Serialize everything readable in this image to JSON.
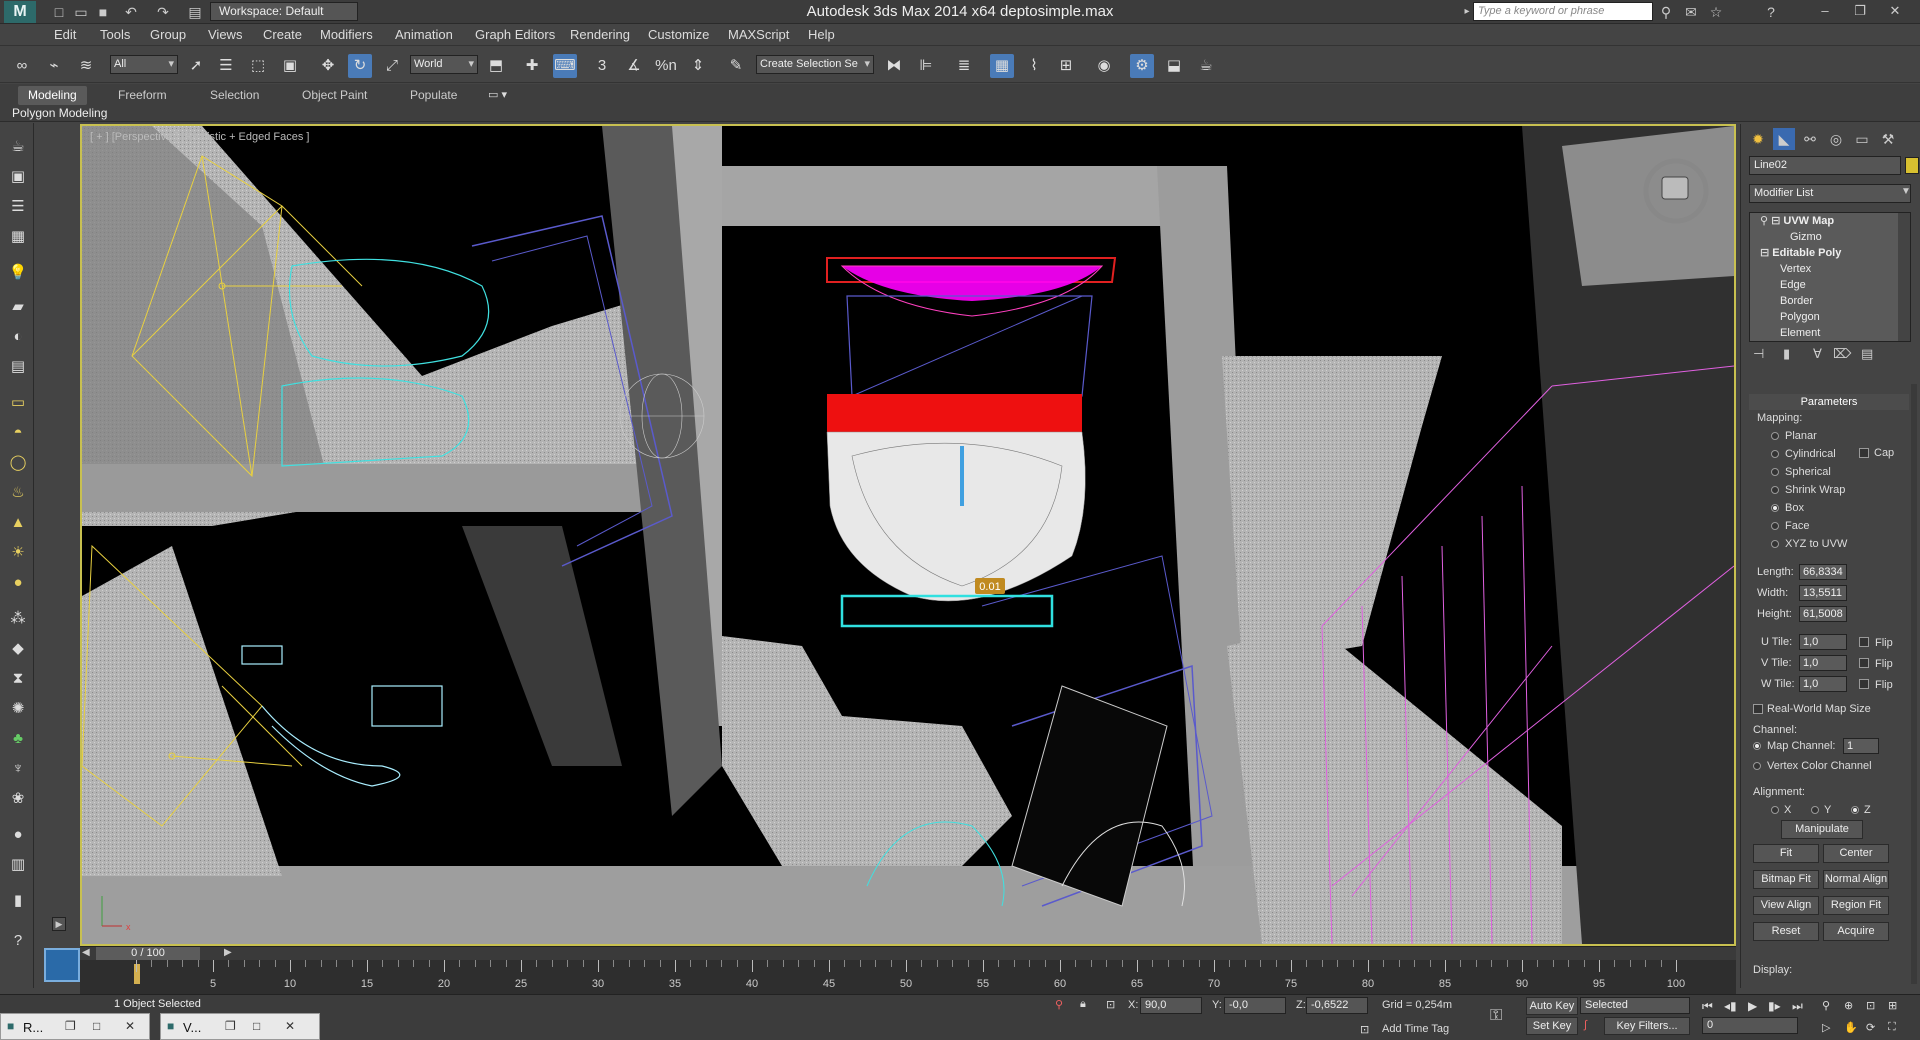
{
  "titlebar": {
    "workspace": "Workspace: Default",
    "app_title": "Autodesk 3ds Max  2014 x64     deptosimple.max",
    "search_placeholder": "Type a keyword or phrase"
  },
  "menu": [
    "Edit",
    "Tools",
    "Group",
    "Views",
    "Create",
    "Modifiers",
    "Animation",
    "Graph Editors",
    "Rendering",
    "Customize",
    "MAXScript",
    "Help"
  ],
  "toolbar": {
    "selection_filter": "All",
    "reference_coord": "World",
    "selection_set": "Create Selection Se",
    "snap_3": "3",
    "angle_snap": "%n"
  },
  "ribbon": {
    "tabs": [
      "Modeling",
      "Freeform",
      "Selection",
      "Object Paint",
      "Populate"
    ],
    "active_tab": "Modeling",
    "panel_label": "Polygon Modeling"
  },
  "viewport": {
    "label": "[ + ] [Perspective ] [Realistic + Edged Faces ]",
    "dimension_label": "0.01"
  },
  "command_panel": {
    "object_name": "Line02",
    "modifier_list": "Modifier List",
    "stack": [
      {
        "label": "UVW Map",
        "bold": true
      },
      {
        "label": "Gizmo",
        "bold": false
      },
      {
        "label": "Editable Poly",
        "bold": true
      },
      {
        "label": "Vertex",
        "bold": false
      },
      {
        "label": "Edge",
        "bold": false
      },
      {
        "label": "Border",
        "bold": false
      },
      {
        "label": "Polygon",
        "bold": false
      },
      {
        "label": "Element",
        "bold": false
      }
    ],
    "parameters_title": "Parameters",
    "mapping_label": "Mapping:",
    "mapping_options": [
      "Planar",
      "Cylindrical",
      "Spherical",
      "Shrink Wrap",
      "Box",
      "Face",
      "XYZ to UVW"
    ],
    "mapping_selected": "Box",
    "cap_label": "Cap",
    "length_label": "Length:",
    "length_value": "66,8334",
    "width_label": "Width:",
    "width_value": "13,5511",
    "height_label": "Height:",
    "height_value": "61,5008",
    "utile_label": "U Tile:",
    "utile_value": "1,0",
    "vtile_label": "V Tile:",
    "vtile_value": "1,0",
    "wtile_label": "W Tile:",
    "wtile_value": "1,0",
    "flip_label": "Flip",
    "realworld_label": "Real-World Map Size",
    "channel_label": "Channel:",
    "map_channel_label": "Map Channel:",
    "map_channel_value": "1",
    "vertex_color_label": "Vertex Color Channel",
    "alignment_label": "Alignment:",
    "axis_x": "X",
    "axis_y": "Y",
    "axis_z": "Z",
    "manipulate": "Manipulate",
    "fit": "Fit",
    "center": "Center",
    "bitmap_fit": "Bitmap Fit",
    "normal_align": "Normal Align",
    "view_align": "View Align",
    "region_fit": "Region Fit",
    "reset": "Reset",
    "acquire": "Acquire",
    "display_label": "Display:"
  },
  "timeline": {
    "frame_display": "0 / 100",
    "ticks": [
      "0",
      "5",
      "10",
      "15",
      "20",
      "25",
      "30",
      "35",
      "40",
      "45",
      "50",
      "55",
      "60",
      "65",
      "70",
      "75",
      "80",
      "85",
      "90",
      "95",
      "100"
    ]
  },
  "status": {
    "selection_text": "1 Object Selected",
    "x_label": "X:",
    "x_value": "90,0",
    "y_label": "Y:",
    "y_value": "-0,0",
    "z_label": "Z:",
    "z_value": "-0,6522",
    "grid": "Grid = 0,254m",
    "add_time_tag": "Add Time Tag",
    "auto_key": "Auto Key",
    "set_key": "Set Key",
    "key_mode": "Selected",
    "key_filters": "Key Filters...",
    "current_frame": "0"
  },
  "taskbar": {
    "win1": "R...",
    "win2": "V..."
  },
  "colors": {
    "ui_bg": "#444444",
    "viewport_border": "#c8c050",
    "sink_selection": "#ff00ff",
    "cyan_wire": "#40e0e0"
  }
}
